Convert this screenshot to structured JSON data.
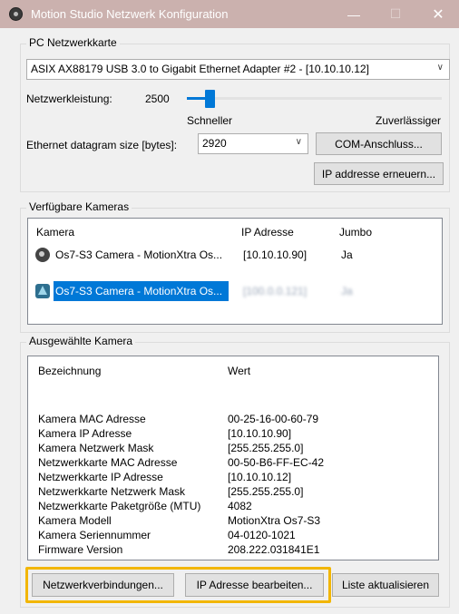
{
  "window": {
    "title": "Motion Studio Netzwerk Konfiguration",
    "min_glyph": "—",
    "max_glyph": "☐",
    "close_glyph": "✕",
    "title_bg": "#cbb1ae"
  },
  "pc_network_card": {
    "group_label": "PC Netzwerkkarte",
    "adapter_selected": "ASIX AX88179 USB 3.0 to Gigabit Ethernet Adapter #2 - [10.10.10.12]",
    "performance_label": "Netzwerkleistung:",
    "performance_value": "2500",
    "slider_level_percent": 9,
    "slider_left_label": "Schneller",
    "slider_right_label": "Zuverlässiger",
    "datagram_label": "Ethernet datagram size [bytes]:",
    "datagram_value": "2920",
    "com_button": "COM-Anschluss...",
    "renew_ip_button": "IP addresse erneuern..."
  },
  "available_cameras": {
    "group_label": "Verfügbare Kameras",
    "columns": [
      "Kamera",
      "IP Adresse",
      "Jumbo"
    ],
    "rows": [
      {
        "name": "Os7-S3 Camera - MotionXtra Os...",
        "ip": "[10.10.10.90]",
        "jumbo": "Ja",
        "selected": false,
        "icon": "camera-gray-icon"
      },
      {
        "name": "Os7-S3 Camera - MotionXtra Os...",
        "ip": "[100.0.0.121]",
        "jumbo": "Ja",
        "selected": true,
        "icon": "camera-warning-icon"
      }
    ]
  },
  "selected_camera": {
    "group_label": "Ausgewählte Kamera",
    "columns": [
      "Bezeichnung",
      "Wert"
    ],
    "rows": [
      {
        "key": "Kamera MAC Adresse",
        "value": "00-25-16-00-60-79"
      },
      {
        "key": "Kamera IP Adresse",
        "value": "[10.10.10.90]"
      },
      {
        "key": "Kamera Netzwerk Mask",
        "value": "[255.255.255.0]"
      },
      {
        "key": "Netzwerkkarte MAC Adresse",
        "value": "00-50-B6-FF-EC-42"
      },
      {
        "key": "Netzwerkkarte IP Adresse",
        "value": "[10.10.10.12]"
      },
      {
        "key": "Netzwerkkarte Netzwerk Mask",
        "value": "[255.255.255.0]"
      },
      {
        "key": "Netzwerkkarte Paketgröße (MTU)",
        "value": "4082"
      },
      {
        "key": "Kamera Modell",
        "value": "MotionXtra Os7-S3"
      },
      {
        "key": "Kamera Seriennummer",
        "value": "04-0120-1021"
      },
      {
        "key": "Firmware Version",
        "value": "208.222.031841E1"
      }
    ]
  },
  "footer": {
    "network_connections_button": "Netzwerkverbindungen...",
    "edit_ip_button": "IP Adresse bearbeiten...",
    "refresh_list_button": "Liste aktualisieren",
    "highlight_color": "#f2b600"
  }
}
